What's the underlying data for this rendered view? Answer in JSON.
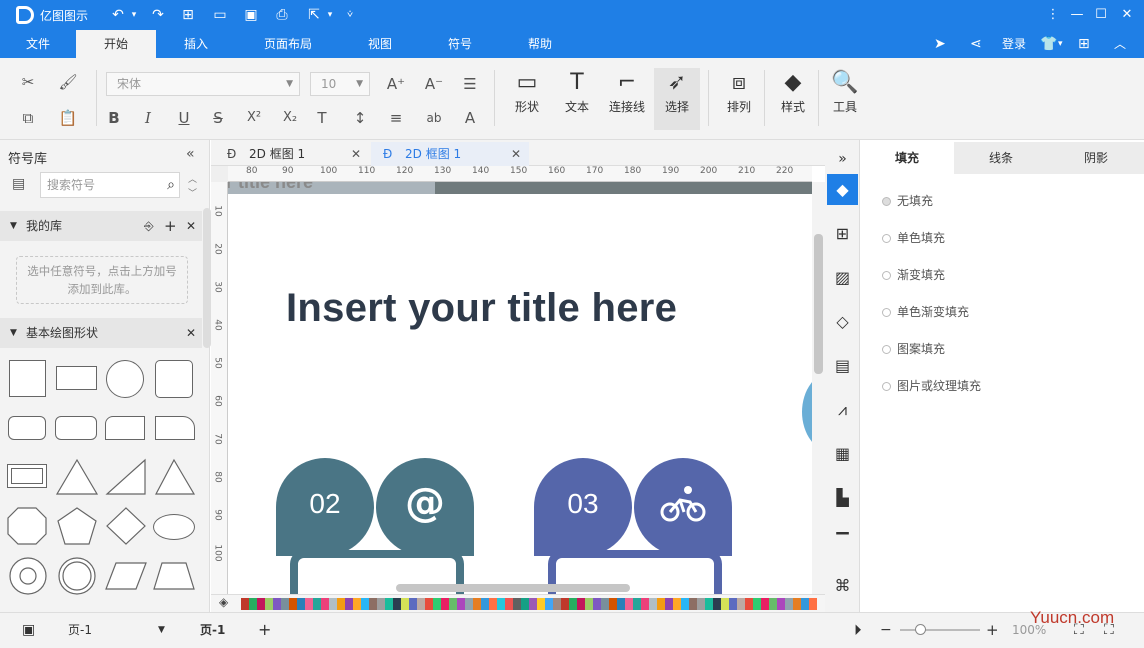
{
  "app": {
    "name": "亿图图示"
  },
  "menus": [
    "文件",
    "开始",
    "插入",
    "页面布局",
    "视图",
    "符号",
    "帮助"
  ],
  "active_menu": "开始",
  "login": "登录",
  "font": {
    "name": "宋体",
    "size": "10"
  },
  "big_buttons": {
    "shape": "形状",
    "text": "文本",
    "connector": "连接线",
    "select": "选择",
    "arrange": "排列",
    "style": "样式",
    "tools": "工具"
  },
  "left_panel": {
    "title": "符号库",
    "search_placeholder": "搜索符号",
    "my_library": "我的库",
    "hint": "选中任意符号，点击上方加号添加到此库。",
    "basic_shapes": "基本绘图形状"
  },
  "doc_tabs": [
    {
      "label": "2D 框图 1"
    },
    {
      "label": "2D 框图 1"
    }
  ],
  "ruler_h": [
    "80",
    "90",
    "100",
    "110",
    "120",
    "130",
    "140",
    "150",
    "160",
    "170",
    "180",
    "190",
    "200",
    "210",
    "220"
  ],
  "ruler_v": [
    "10",
    "20",
    "30",
    "40",
    "50",
    "60",
    "70",
    "80",
    "90",
    "100"
  ],
  "canvas": {
    "title": "Insert your title here",
    "header_text": "r title here",
    "item1": {
      "number": "02",
      "icon": "at-icon"
    },
    "item2": {
      "number": "03",
      "icon": "bicycle-icon"
    },
    "colors": {
      "item1": "#4a7585",
      "item2": "#5566aa",
      "title": "#2e3a4a"
    }
  },
  "right_panel": {
    "tabs": [
      "填充",
      "线条",
      "阴影"
    ],
    "active_tab": "填充",
    "options": [
      "无填充",
      "单色填充",
      "渐变填充",
      "单色渐变填充",
      "图案填充",
      "图片或纹理填充"
    ]
  },
  "status": {
    "page_select": "页-1",
    "page_tab": "页-1",
    "add": "+",
    "zoom_label": "100%"
  },
  "watermark": "Yuucn.com",
  "accent": "#1f7fe6"
}
